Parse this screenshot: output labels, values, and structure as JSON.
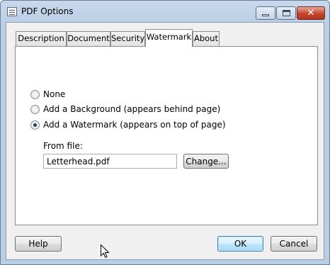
{
  "window": {
    "title": "PDF Options",
    "close_glyph": "✕"
  },
  "tabs": [
    {
      "label": "Description",
      "active": false
    },
    {
      "label": "Document",
      "active": false
    },
    {
      "label": "Security",
      "active": false
    },
    {
      "label": "Watermark",
      "active": true
    },
    {
      "label": "About",
      "active": false
    }
  ],
  "options": {
    "none_label": "None",
    "background_label": "Add a Background (appears behind page)",
    "watermark_label": "Add a Watermark (appears on top of page)",
    "selected": "watermark"
  },
  "file": {
    "label": "From file:",
    "value": "Letterhead.pdf",
    "change_label": "Change..."
  },
  "footer": {
    "help_label": "Help",
    "ok_label": "OK",
    "cancel_label": "Cancel"
  },
  "icons": {
    "app": "document-window-icon",
    "minimize": "minimize-icon",
    "maximize": "maximize-icon",
    "close": "close-icon",
    "cursor": "mouse-pointer-icon"
  },
  "colors": {
    "title_bar": "#b9cde5",
    "close_button": "#c4452c",
    "default_button_border": "#3c7fb1"
  }
}
